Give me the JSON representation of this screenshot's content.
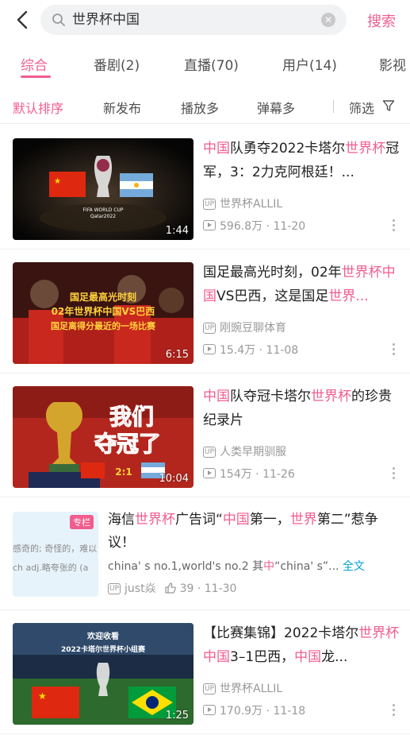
{
  "search": {
    "query": "世界杯中国",
    "button_label": "搜索"
  },
  "tabs": [
    {
      "label": "综合",
      "active": true
    },
    {
      "label": "番剧(2)"
    },
    {
      "label": "直播(70)"
    },
    {
      "label": "用户(14)"
    },
    {
      "label": "影视"
    }
  ],
  "filters": {
    "items": [
      "默认排序",
      "新发布",
      "播放多",
      "弹幕多"
    ],
    "filter_label": "筛选"
  },
  "videos": [
    {
      "title_parts": [
        {
          "t": "中国",
          "hl": true
        },
        {
          "t": "队勇夺2022卡塔尔",
          "hl": false
        },
        {
          "t": "世界杯",
          "hl": true
        },
        {
          "t": "冠军，3：2力克阿根廷！...",
          "hl": false
        }
      ],
      "uploader": "世界杯ALLIL",
      "views": "596.8万",
      "date": "11-20",
      "duration": "1:44"
    },
    {
      "title_parts": [
        {
          "t": "国足最高光时刻，02年",
          "hl": false
        },
        {
          "t": "世界杯",
          "hl": true
        },
        {
          "t": "中国",
          "hl": true
        },
        {
          "t": "VS巴西，这是国足",
          "hl": false
        },
        {
          "t": "世界...",
          "hl": true
        }
      ],
      "uploader": "刚豌豆聊体育",
      "views": "15.4万",
      "date": "11-08",
      "duration": "6:15",
      "overlay_text": [
        "国足最高光时刻",
        "02年世界杯中国VS巴西",
        "国足离得分最近的一场比赛"
      ]
    },
    {
      "title_parts": [
        {
          "t": "中国",
          "hl": true
        },
        {
          "t": "队夺冠卡塔尔",
          "hl": false
        },
        {
          "t": "世界杯",
          "hl": true
        },
        {
          "t": "的珍贵纪录片",
          "hl": false
        }
      ],
      "uploader": "人类早期驯服",
      "views": "154万",
      "date": "11-26",
      "duration": "10:04",
      "overlay_text": [
        "我们",
        "夺冠了",
        "2:1"
      ]
    },
    {
      "title_parts": [
        {
          "t": "【比赛集锦】2022卡塔尔",
          "hl": false
        },
        {
          "t": "世界杯",
          "hl": true
        },
        {
          "t": "中国",
          "hl": true
        },
        {
          "t": "3–1巴西，",
          "hl": false
        },
        {
          "t": "中国",
          "hl": true
        },
        {
          "t": "龙...",
          "hl": false
        }
      ],
      "uploader": "世界杯ALLIL",
      "views": "170.9万",
      "date": "11-18",
      "duration": "1:25",
      "overlay_text": [
        "欢迎收看",
        "2022卡塔尔世界杯小组赛"
      ]
    }
  ],
  "article": {
    "badge": "专栏",
    "thumb_lines": [
      "感奇的; 奇怪的，难以",
      "ch adj.略夸张的 (a"
    ],
    "title_parts": [
      {
        "t": "海信",
        "hl": false
      },
      {
        "t": "世界杯",
        "hl": true
      },
      {
        "t": "广告词“",
        "hl": false
      },
      {
        "t": "中国",
        "hl": true
      },
      {
        "t": "第一，",
        "hl": false
      },
      {
        "t": "世界",
        "hl": true
      },
      {
        "t": "第二”惹争议！",
        "hl": false
      }
    ],
    "desc_parts": [
      {
        "t": "china' s no.1,world's no.2  其",
        "hl": false
      },
      {
        "t": "中",
        "hl": true
      },
      {
        "t": "“china' s”...",
        "hl": false
      }
    ],
    "desc_full": "全文",
    "author": "just焱",
    "likes": "39",
    "date": "11-30"
  },
  "colors": {
    "accent": "#f25d8e",
    "link": "#00a1d6"
  }
}
